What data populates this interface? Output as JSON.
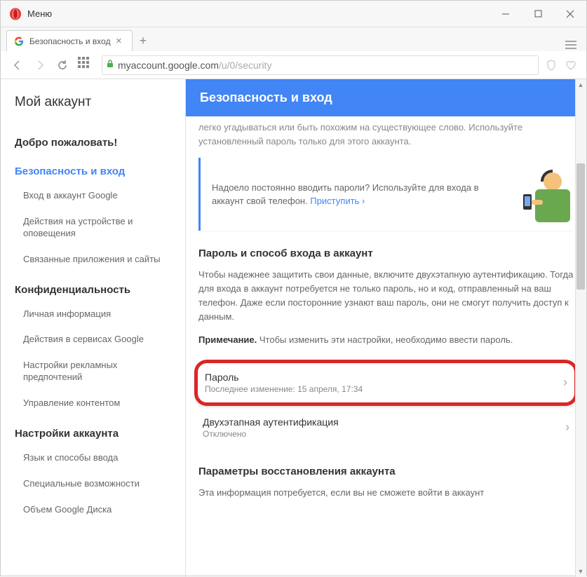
{
  "titlebar": {
    "menu": "Меню"
  },
  "tab": {
    "title": "Безопасность и вход"
  },
  "url": {
    "host": "myaccount.google.com",
    "path": "/u/0/security"
  },
  "sidebar": {
    "title": "Мой аккаунт",
    "welcome": "Добро пожаловать!",
    "sec_security": "Безопасность и вход",
    "items_security": [
      "Вход в аккаунт Google",
      "Действия на устройстве и оповещения",
      "Связанные приложения и сайты"
    ],
    "sec_privacy": "Конфиденциальность",
    "items_privacy": [
      "Личная информация",
      "Действия в сервисах Google",
      "Настройки рекламных предпочтений",
      "Управление контентом"
    ],
    "sec_settings": "Настройки аккаунта",
    "items_settings": [
      "Язык и способы ввода",
      "Специальные возможности",
      "Объем Google Диска"
    ]
  },
  "main": {
    "header": "Безопасность и вход",
    "faded": "легко угадываться или быть похожим на существующее слово. Используйте установленный пароль только для этого аккаунта.",
    "promo_text": "Надоело постоянно вводить пароли? Используйте для входа в аккаунт свой телефон. ",
    "promo_link": "Приступить",
    "section_title": "Пароль и способ входа в аккаунт",
    "section_text": "Чтобы надежнее защитить свои данные, включите двухэтапную аутентификацию. Тогда для входа в аккаунт потребуется не только пароль, но и код, отправленный на ваш телефон. Даже если посторонние узнают ваш пароль, они не смогут получить доступ к данным.",
    "note_label": "Примечание.",
    "note_text": " Чтобы изменить эти настройки, необходимо ввести пароль.",
    "password_row": {
      "title": "Пароль",
      "sub": "Последнее изменение: 15 апреля, 17:34"
    },
    "twostep_row": {
      "title": "Двухэтапная аутентификация",
      "sub": "Отключено"
    },
    "recovery_title": "Параметры восстановления аккаунта",
    "recovery_text": "Эта информация потребуется, если вы не сможете войти в аккаунт"
  }
}
